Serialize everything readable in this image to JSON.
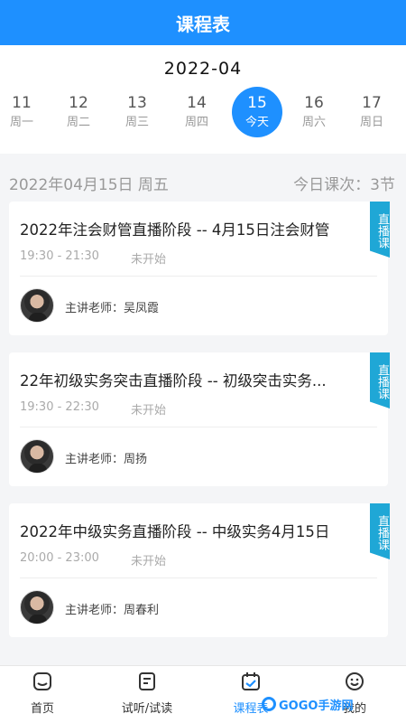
{
  "header": {
    "title": "课程表"
  },
  "calendar": {
    "month": "2022-04",
    "days": [
      {
        "num": "11",
        "weekday": "周一",
        "active": false
      },
      {
        "num": "12",
        "weekday": "周二",
        "active": false
      },
      {
        "num": "13",
        "weekday": "周三",
        "active": false
      },
      {
        "num": "14",
        "weekday": "周四",
        "active": false
      },
      {
        "num": "15",
        "weekday": "今天",
        "active": true
      },
      {
        "num": "16",
        "weekday": "周六",
        "active": false
      },
      {
        "num": "17",
        "weekday": "周日",
        "active": false
      }
    ]
  },
  "summary": {
    "date": "2022年04月15日  周五",
    "count": "今日课次：3节"
  },
  "courses": [
    {
      "title": "2022年注会财管直播阶段 -- 4月15日注会财管",
      "time": "19:30 - 21:30",
      "status": "未开始",
      "teacher": "主讲老师：吴凤霞",
      "badge": "直播课"
    },
    {
      "title": "22年初级实务突击直播阶段 -- 初级突击实务...",
      "time": "19:30 - 22:30",
      "status": "未开始",
      "teacher": "主讲老师：周扬",
      "badge": "直播课"
    },
    {
      "title": "2022年中级实务直播阶段 -- 中级实务4月15日",
      "time": "20:00 - 23:00",
      "status": "未开始",
      "teacher": "主讲老师：周春利",
      "badge": "直播课"
    }
  ],
  "tabbar": {
    "items": [
      {
        "label": "首页",
        "icon": "home-icon"
      },
      {
        "label": "试听/试读",
        "icon": "book-icon"
      },
      {
        "label": "课程表",
        "icon": "calendar-check-icon"
      },
      {
        "label": "我的",
        "icon": "smile-icon"
      }
    ]
  },
  "watermark": {
    "text": "GOGO手游网"
  },
  "colors": {
    "accent": "#1e90ff",
    "badge": "#1fa7d6"
  }
}
